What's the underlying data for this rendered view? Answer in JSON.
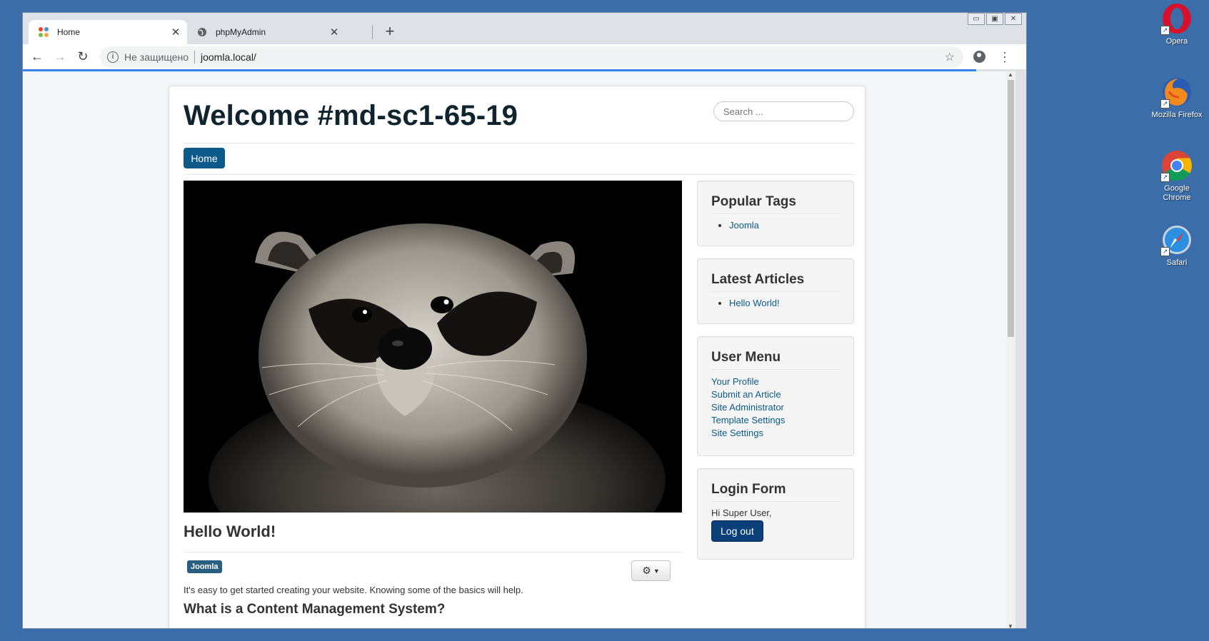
{
  "browser": {
    "tabs": [
      {
        "title": "Home",
        "active": true
      },
      {
        "title": "phpMyAdmin",
        "active": false
      }
    ],
    "new_tab": "+",
    "security_text": "Не защищено",
    "url": "joomla.local/"
  },
  "site": {
    "title": "Welcome #md-sc1-65-19",
    "search_placeholder": "Search ...",
    "nav": [
      "Home"
    ],
    "article": {
      "title": "Hello World!",
      "tag": "Joomla",
      "intro": "It's easy to get started creating your website. Knowing some of the basics will help.",
      "subheading": "What is a Content Management System?"
    },
    "modules": {
      "popular_tags": {
        "title": "Popular Tags",
        "items": [
          "Joomla"
        ]
      },
      "latest_articles": {
        "title": "Latest Articles",
        "items": [
          "Hello World!"
        ]
      },
      "user_menu": {
        "title": "User Menu",
        "items": [
          "Your Profile",
          "Submit an Article",
          "Site Administrator",
          "Template Settings",
          "Site Settings"
        ]
      },
      "login_form": {
        "title": "Login Form",
        "greeting": "Hi Super User,",
        "logout_label": "Log out"
      }
    }
  },
  "desktop": {
    "icons": [
      {
        "label": "Opera",
        "icon": "opera-icon"
      },
      {
        "label": "Mozilla Firefox",
        "icon": "firefox-icon"
      },
      {
        "label": "Google Chrome",
        "icon": "chrome-icon"
      },
      {
        "label": "Safari",
        "icon": "safari-icon"
      }
    ]
  },
  "colors": {
    "desktop_bg": "#3b6ea8",
    "brand_blue": "#0b5a8a",
    "logout_blue": "#0b3f7a"
  }
}
